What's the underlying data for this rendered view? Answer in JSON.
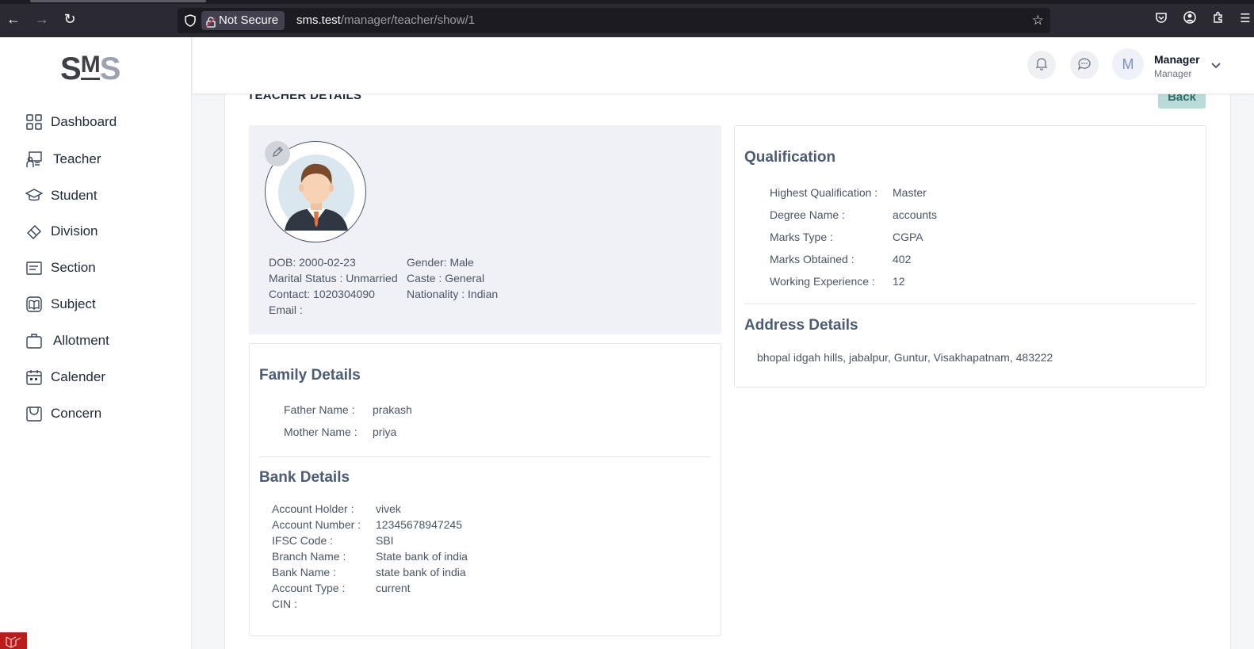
{
  "browser": {
    "security_label": "Not Secure",
    "url_host": "sms.test",
    "url_path": "/manager/teacher/show/1"
  },
  "sidebar": {
    "logo": {
      "s1": "S",
      "m": "M",
      "s2": "S"
    },
    "items": [
      {
        "label": "Dashboard",
        "icon": "grid-icon"
      },
      {
        "label": "Teacher",
        "icon": "teacher-board-icon"
      },
      {
        "label": "Student",
        "icon": "graduation-cap-icon"
      },
      {
        "label": "Division",
        "icon": "eraser-icon"
      },
      {
        "label": "Section",
        "icon": "list-box-icon"
      },
      {
        "label": "Subject",
        "icon": "book-icon"
      },
      {
        "label": "Allotment",
        "icon": "briefcase-icon"
      },
      {
        "label": "Calender",
        "icon": "calendar-icon"
      },
      {
        "label": "Concern",
        "icon": "bag-icon"
      }
    ]
  },
  "header": {
    "avatar_letter": "M",
    "user_name": "Manager",
    "user_role": "Manager"
  },
  "page": {
    "title": "TEACHER DETAILS",
    "back_label": "Back"
  },
  "profile": {
    "dob": "DOB: 2000-02-23",
    "marital": "Marital Status : Unmarried",
    "contact": "Contact: 1020304090",
    "email": "Email :",
    "gender": "Gender: Male",
    "caste": "Caste : General",
    "nationality": "Nationality : Indian"
  },
  "family": {
    "title": "Family Details",
    "rows": [
      {
        "label": "Father Name :",
        "value": "prakash"
      },
      {
        "label": "Mother Name :",
        "value": "priya"
      }
    ]
  },
  "bank": {
    "title": "Bank Details",
    "rows": [
      {
        "label": "Account Holder :",
        "value": "vivek"
      },
      {
        "label": "Account Number :",
        "value": "12345678947245"
      },
      {
        "label": "IFSC Code :",
        "value": "SBI"
      },
      {
        "label": "Branch Name :",
        "value": "State bank of india"
      },
      {
        "label": "Bank Name :",
        "value": "state bank of india"
      },
      {
        "label": "Account Type :",
        "value": "current"
      },
      {
        "label": "CIN :",
        "value": ""
      }
    ]
  },
  "qualification": {
    "title": "Qualification",
    "rows": [
      {
        "label": "Highest Qualification :",
        "value": "Master"
      },
      {
        "label": "Degree Name :",
        "value": "accounts"
      },
      {
        "label": "Marks Type :",
        "value": "CGPA"
      },
      {
        "label": "Marks Obtained :",
        "value": "402"
      },
      {
        "label": "Working Experience :",
        "value": "12"
      }
    ]
  },
  "address": {
    "title": "Address Details",
    "text": "bhopal idgah hills, jabalpur, Guntur, Visakhapatnam, 483222"
  }
}
